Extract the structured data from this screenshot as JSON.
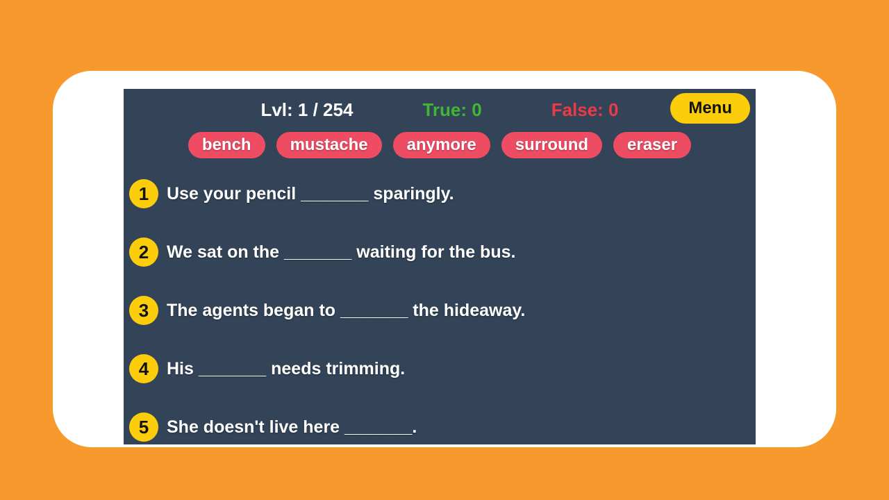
{
  "colors": {
    "background": "#f8992e",
    "screen": "#334459",
    "yellow": "#fccd0a",
    "chip": "#ed4c63",
    "true": "#3fb733",
    "false": "#ed3a48"
  },
  "header": {
    "level_label": "Lvl: 1 / 254",
    "true_label": "True: 0",
    "false_label": "False: 0",
    "menu_label": "Menu"
  },
  "words": [
    "bench",
    "mustache",
    "anymore",
    "surround",
    "eraser"
  ],
  "sentences": [
    {
      "num": "1",
      "text": "Use your pencil _______ sparingly."
    },
    {
      "num": "2",
      "text": "We sat on the _______ waiting for the bus."
    },
    {
      "num": "3",
      "text": "The agents began to _______ the hideaway."
    },
    {
      "num": "4",
      "text": "His _______ needs trimming."
    },
    {
      "num": "5",
      "text": "She doesn't live here _______."
    }
  ]
}
